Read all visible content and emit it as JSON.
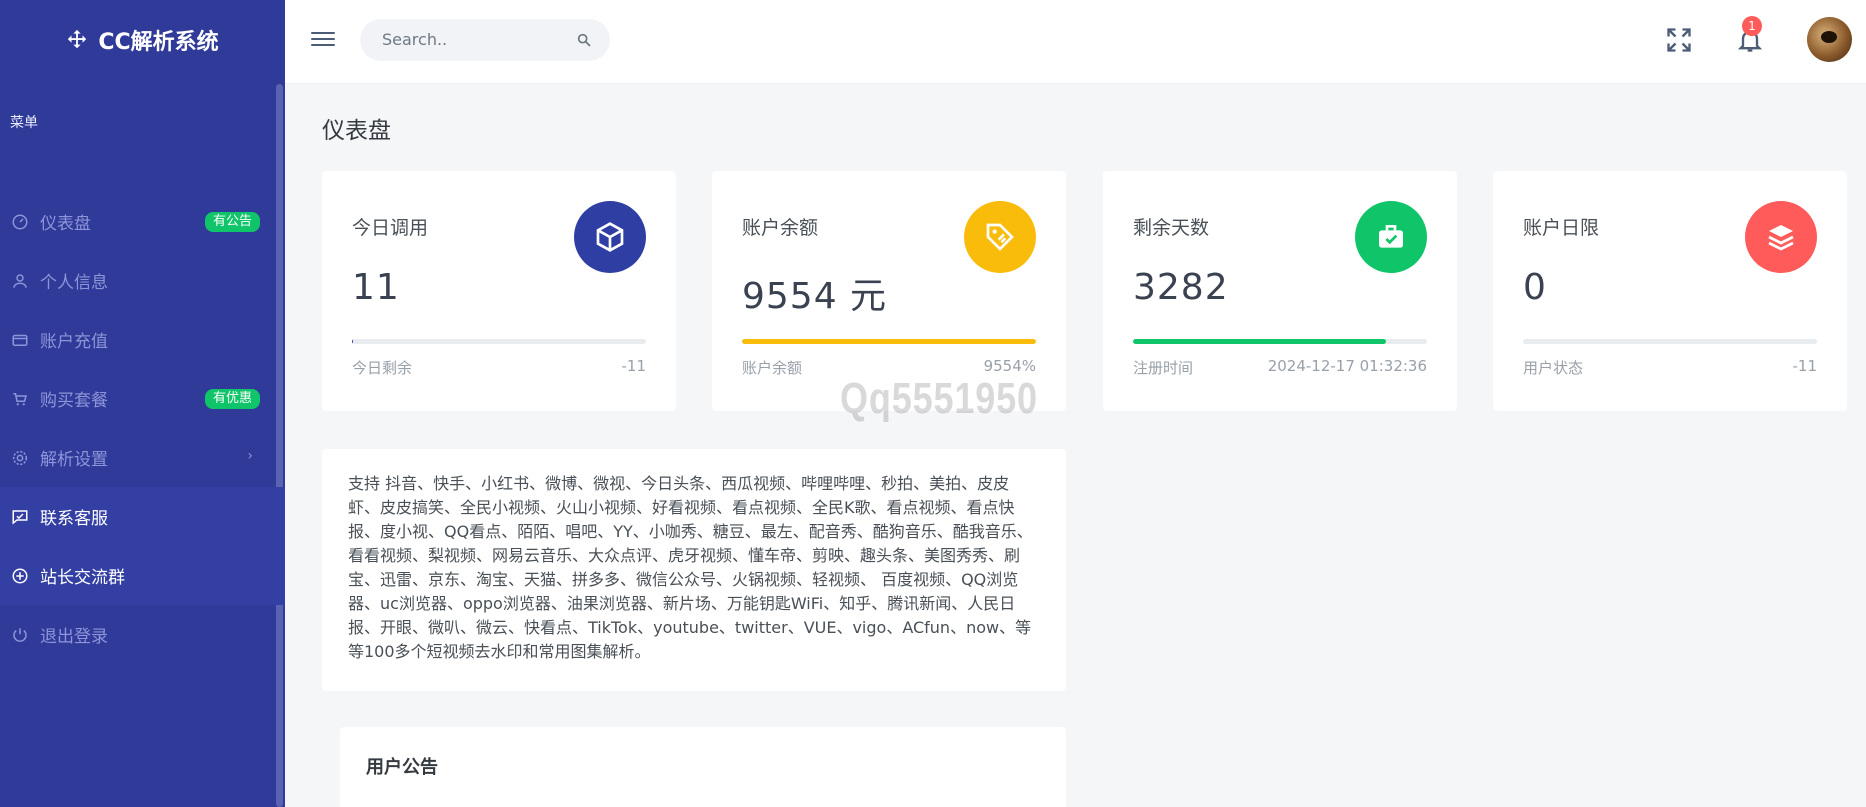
{
  "app": {
    "title": "CC解析系统"
  },
  "sidebar": {
    "section_title": "菜单",
    "items": [
      {
        "label": "仪表盘",
        "badge": "有公告"
      },
      {
        "label": "个人信息"
      },
      {
        "label": "账户充值"
      },
      {
        "label": "购买套餐",
        "badge": "有优惠"
      },
      {
        "label": "解析设置"
      },
      {
        "label": "联系客服"
      },
      {
        "label": "站长交流群"
      },
      {
        "label": "退出登录"
      }
    ]
  },
  "topbar": {
    "search_placeholder": "Search..",
    "notification_count": "1"
  },
  "page": {
    "title": "仪表盘"
  },
  "cards": [
    {
      "label": "今日调用",
      "value": "11",
      "footer_label": "今日剩余",
      "footer_value": "-11",
      "progress": 0.005,
      "color": "#2e3ea3",
      "icon": "cube-icon"
    },
    {
      "label": "账户余额",
      "value": "9554 元",
      "footer_label": "账户余额",
      "footer_value": "9554%",
      "progress": 1.0,
      "color": "#f9bc0b",
      "icon": "tag-icon"
    },
    {
      "label": "剩余天数",
      "value": "3282",
      "footer_label": "注册时间",
      "footer_value": "2024-12-17 01:32:36",
      "progress": 0.86,
      "color": "#10c469",
      "icon": "briefcase-check-icon"
    },
    {
      "label": "账户日限",
      "value": "0",
      "footer_label": "用户状态",
      "footer_value": "-11",
      "progress": 0.0,
      "color": "#ff5b5b",
      "icon": "layers-icon"
    }
  ],
  "watermark": "Qq5551950",
  "description": "支持 抖音、快手、小红书、微博、微视、今日头条、西瓜视频、哔哩哔哩、秒拍、美拍、皮皮虾、皮皮搞笑、全民小视频、火山小视频、好看视频、看点视频、全民K歌、看点视频、看点快报、度小视、QQ看点、陌陌、唱吧、YY、小咖秀、糖豆、最左、配音秀、酷狗音乐、酷我音乐、看看视频、梨视频、网易云音乐、大众点评、虎牙视频、懂车帝、剪映、趣头条、美图秀秀、刷宝、迅雷、京东、淘宝、天猫、拼多多、微信公众号、火锅视频、轻视频、 百度视频、QQ浏览器、uc浏览器、oppo浏览器、油果浏览器、新片场、万能钥匙WiFi、知乎、腾讯新闻、人民日报、开眼、微叭、微云、快看点、TikTok、youtube、twitter、VUE、vigo、ACfun、now、等等100多个短视频去水印和常用图集解析。",
  "notice": {
    "title": "用户公告"
  }
}
